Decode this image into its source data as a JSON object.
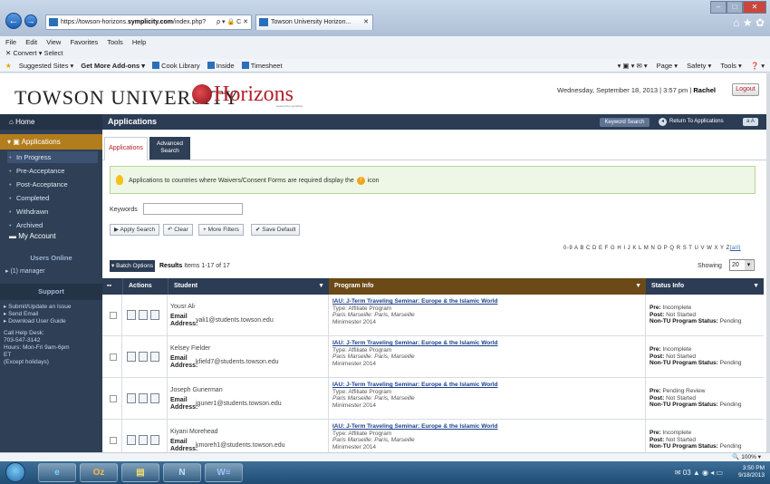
{
  "browser": {
    "address": {
      "prefix": "https://towson-horizons.",
      "domain": "symplicity.com",
      "suffix": "/index.php?",
      "controls": "ρ ▾ 🔒 C ✕"
    },
    "tab_title": "Towson University Horizon...",
    "tab_close": "✕",
    "window_controls": {
      "minimize": "–",
      "maximize": "□",
      "close": "✕"
    },
    "toolbar_icons": "⌂ ★ ✿",
    "menu": [
      "File",
      "Edit",
      "View",
      "Favorites",
      "Tools",
      "Help"
    ],
    "command_bar": "✕  Convert ▾  Select",
    "favorites": {
      "sites": "Suggested Sites ▾",
      "addons": "Get More Add-ons ▾",
      "items": [
        "Cook Library",
        "Inside",
        "Timesheet"
      ]
    },
    "fav_right": [
      "▾ ▣ ▾ ✉ ▾",
      "Page ▾",
      "Safety ▾",
      "Tools ▾",
      "❓ ▾"
    ],
    "zoom": "🔍 100% ▾"
  },
  "header": {
    "logo_text": "TOWSON UNIVERSITY",
    "horizons": "Horizons",
    "tagline": "powered by symplicity",
    "datetime": "Wednesday, September 18, 2013 | 3:57 pm | ",
    "user": "Rachel",
    "logout": "Logout"
  },
  "sidebar": {
    "home": "Home",
    "applications": "Applications",
    "sub_items": [
      "In Progress",
      "Pre-Acceptance",
      "Post-Acceptance",
      "Completed",
      "Withdrawn",
      "Archived"
    ],
    "my_account": "My Account",
    "users_online": "Users Online",
    "manager": "▸ (1) manager",
    "support": "Support",
    "support_links": [
      "▸ Submit/Update an Issue",
      "▸ Send Email",
      "▸ Download User Guide"
    ],
    "help_desk": "Call Help Desk:\n703-547-3142\nHours: Mon-Fri 9am-6pm\nET\n(Except holidays)"
  },
  "main": {
    "title": "Applications",
    "keyword_search_btn": "Keyword Search",
    "return_btn": "Return To Applications",
    "return_icon": "◂",
    "aa_btn": "a A",
    "tabs": {
      "applications": "Applications",
      "advanced": "Advanced\nSearch"
    },
    "notice": {
      "before": "Applications to countries where Waivers/Consent Forms are required display the ",
      "icon": "!",
      "after": " icon"
    },
    "keywords_label": "Keywords",
    "buttons": [
      "▶ Apply Search",
      "↶ Clear",
      "+ More Filters",
      "✔ Save Default"
    ],
    "alphabet": "0-9 A B C D E F G H I J K L M N O P Q R S T U V W X Y Z",
    "alphabet_all": "[all]",
    "batch": "▾ Batch Options",
    "results_label": "Results",
    "results_text": " Items 1-17 of 17",
    "showing_label": "Showing",
    "showing_value": "20"
  },
  "table": {
    "headers": {
      "select": "▪▪",
      "actions": "Actions",
      "student": "Student",
      "program": "Program Info",
      "status": "Status Info",
      "sort_arrow": "▼"
    },
    "rows": [
      {
        "name": "Yousr Ali",
        "email_label": "Email Address:",
        "email": "yali1@students.towson.edu",
        "program": "IAU: J-Term Traveling Seminar: Europe & the Islamic World",
        "type": "Type: Affiliate Program",
        "location": "Paris Marseille: Paris, Marseille",
        "term": "Minimester 2014",
        "pre": "Incomplete",
        "post": "Not Started",
        "nontu": "Pending"
      },
      {
        "name": "Kelsey Fielder",
        "email_label": "Email Address:",
        "email": "kfield7@students.towson.edu",
        "program": "IAU: J-Term Traveling Seminar: Europe & the Islamic World",
        "type": "Type: Affiliate Program",
        "location": "Paris Marseille: Paris, Marseille",
        "term": "Minimester 2014",
        "pre": "Incomplete",
        "post": "Not Started",
        "nontu": "Pending"
      },
      {
        "name": "Joseph Gunerman",
        "email_label": "Email Address:",
        "email": "jguner1@students.towson.edu",
        "program": "IAU: J-Term Traveling Seminar: Europe & the Islamic World",
        "type": "Type: Affiliate Program",
        "location": "Paris Marseille: Paris, Marseille",
        "term": "Minimester 2014",
        "pre": "Pending Review",
        "post": "Not Started",
        "nontu": "Pending"
      },
      {
        "name": "Kiyani Morehead",
        "email_label": "Email Address:",
        "email": "kmoreh1@students.towson.edu",
        "program": "IAU: J-Term Traveling Seminar: Europe & the Islamic World",
        "type": "Type: Affiliate Program",
        "location": "Paris Marseille: Paris, Marseille",
        "term": "Minimester 2014",
        "pre": "Incomplete",
        "post": "Not Started",
        "nontu": "Pending"
      }
    ],
    "labels": {
      "pre": "Pre:",
      "post": "Post:",
      "nontu": "Non-TU Program Status:"
    }
  },
  "taskbar": {
    "time": "3:50 PM",
    "date": "9/18/2013",
    "apps": [
      "e",
      "Oz",
      "▤",
      "N",
      "W≡"
    ],
    "tray": "✉ 03 ▲ ◉ ◂ ▭"
  },
  "colors": {
    "sidebar": "#2e3f56",
    "accent_gold": "#b27d1c",
    "brand_red": "#b3202b",
    "program_header": "#6b4a17"
  }
}
